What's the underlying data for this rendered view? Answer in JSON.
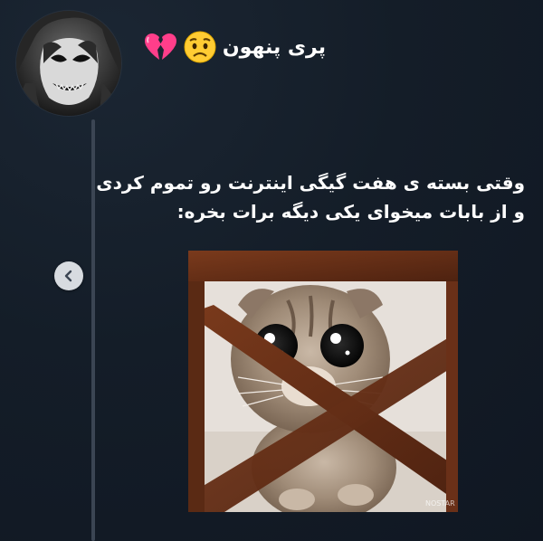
{
  "tweet": {
    "author": {
      "display_name": "پری پنهون",
      "name_emojis": [
        "broken-heart-icon",
        "worried-face-icon"
      ]
    },
    "text_lines": [
      "وقتی بسته ی هفت گیگی اینترنت رو تموم کردی",
      "و از بابات میخوای یکی دیگه برات بخره:"
    ],
    "media": {
      "icon": "kitten-photo",
      "watermark": "NOSTAR"
    }
  },
  "controls": {
    "back_icon": "chevron-left-icon"
  },
  "colors": {
    "background": "#15202b",
    "text": "#ffffff",
    "thread_line": "#3b4553",
    "button_bg": "#d7dbe0"
  }
}
